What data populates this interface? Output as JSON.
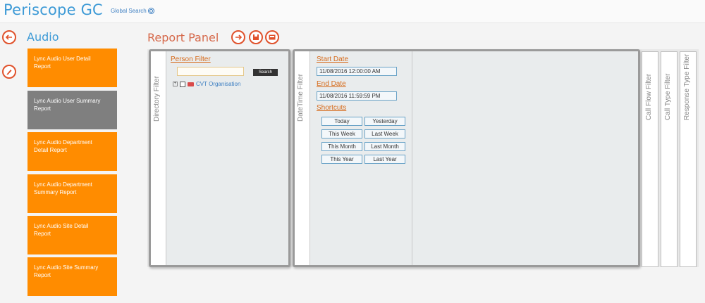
{
  "app": {
    "title": "Periscope GC",
    "global_search": "Global Search"
  },
  "section": {
    "title": "Audio"
  },
  "panel": {
    "title": "Report Panel"
  },
  "reports": [
    {
      "line1": "Lync Audio User Detail",
      "line2": "Report"
    },
    {
      "line1": "Lync Audio User Summary",
      "line2": "Report"
    },
    {
      "line1": "Lync Audio Department",
      "line2": "Detail Report"
    },
    {
      "line1": "Lync Audio Department",
      "line2": "Summary Report"
    },
    {
      "line1": "Lync Audio Site Detail",
      "line2": "Report"
    },
    {
      "line1": "Lync Audio Site Summary",
      "line2": "Report"
    }
  ],
  "directory_filter": {
    "tab_label": "Directory Filter",
    "person_filter": "Person Filter",
    "search_value": "",
    "search_button": "Search",
    "tree_node": "CVT Organisation"
  },
  "datetime_filter": {
    "tab_label": "DateTime Filter",
    "start_label": "Start Date",
    "start_value": "11/08/2016 12:00:00 AM",
    "end_label": "End Date",
    "end_value": "11/08/2016 11:59:59 PM",
    "shortcuts_label": "Shortcuts",
    "shortcuts": [
      "Today",
      "Yesterday",
      "This Week",
      "Last Week",
      "This Month",
      "Last Month",
      "This Year",
      "Last Year"
    ]
  },
  "side_tabs": [
    "Call Flow Filter",
    "Call Type Filter",
    "Response Type Filter"
  ],
  "colors": {
    "brand_blue": "#3d9ad6",
    "accent_orange": "#ff8c00",
    "active_tile": "#7f7f7f",
    "icon_red": "#e0522c"
  }
}
